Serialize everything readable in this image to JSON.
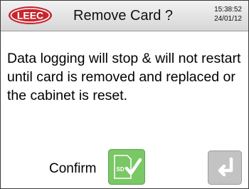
{
  "header": {
    "logo_text": "LEEC",
    "title": "Remove Card ?",
    "time": "15:38:52",
    "date": "24/01/12"
  },
  "message": "Data logging will stop & will not restart until card is removed and replaced or the cabinet is reset.",
  "actions": {
    "confirm_label": "Confirm",
    "confirm_icon": "sd-card-check-icon",
    "back_icon": "enter-return-icon"
  },
  "colors": {
    "logo_red": "#c6262e",
    "confirm_green": "#79c765",
    "back_gray": "#c3c3c3"
  }
}
